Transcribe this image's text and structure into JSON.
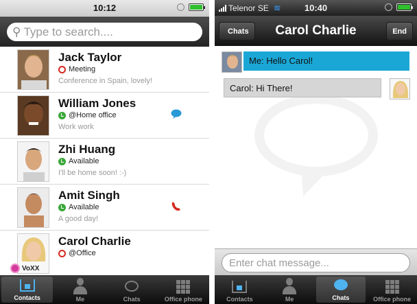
{
  "left": {
    "status_time": "10:12",
    "search_placeholder": "Type to search....",
    "contacts": [
      {
        "name": "Jack Taylor",
        "status": "Meeting",
        "status_color": "red",
        "message": "Conference in Spain, lovely!",
        "action_icon": ""
      },
      {
        "name": "William Jones",
        "status": "@Home office",
        "status_color": "green",
        "message": "Work work",
        "action_icon": "chat-bubble-icon"
      },
      {
        "name": "Zhi Huang",
        "status": "Available",
        "status_color": "green",
        "message": "I'll be home soon! :-)",
        "action_icon": ""
      },
      {
        "name": "Amit Singh",
        "status": "Available",
        "status_color": "green",
        "message": "A good day!",
        "action_icon": "phone-icon"
      },
      {
        "name": "Carol Charlie",
        "status": "@Office",
        "status_color": "red",
        "message": "",
        "action_icon": ""
      }
    ],
    "logo_text": "VoXX",
    "tabs": [
      "Contacts",
      "Me",
      "Chats",
      "Office phone"
    ],
    "selected_tab": "Contacts"
  },
  "right": {
    "carrier": "Telenor SE",
    "status_time": "10:40",
    "nav_title": "Carol Charlie",
    "back_label": "Chats",
    "end_label": "End",
    "messages": [
      {
        "from": "me",
        "text": "Me: Hello Carol!"
      },
      {
        "from": "carol",
        "text": "Carol: Hi There!"
      }
    ],
    "input_placeholder": "Enter chat message...",
    "tabs": [
      "Contacts",
      "Me",
      "Chats",
      "Office phone"
    ],
    "selected_tab": "Chats"
  },
  "colors": {
    "accent_blue": "#1ba7d6",
    "status_red": "#d6281e",
    "status_green": "#3aa83a",
    "voxx_pink": "#d33a9b"
  }
}
